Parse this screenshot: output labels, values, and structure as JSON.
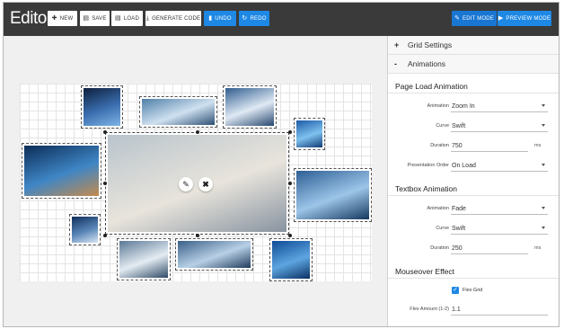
{
  "header": {
    "title": "Editor",
    "buttons": [
      {
        "label": "NEW",
        "icon": "plus-icon"
      },
      {
        "label": "SAVE",
        "icon": "save-icon"
      },
      {
        "label": "LOAD",
        "icon": "load-icon"
      },
      {
        "label": "GENERATE CODE",
        "icon": "download-icon"
      },
      {
        "label": "UNDO",
        "icon": "trash-icon"
      },
      {
        "label": "REDO",
        "icon": "redo-icon"
      }
    ],
    "modes": [
      {
        "label": "EDIT MODE",
        "icon": "edit-mode-icon"
      },
      {
        "label": "PREVIEW MODE",
        "icon": "play-icon"
      }
    ]
  },
  "canvas": {
    "images": [
      {
        "name": "galaxy",
        "colors": [
          "#0d1f3d",
          "#3b6fb0",
          "#7fb4e6"
        ]
      },
      {
        "name": "mountain-lake-wide",
        "colors": [
          "#4f7fa8",
          "#cfe1f0",
          "#2c4e73"
        ]
      },
      {
        "name": "snowy-peaks",
        "colors": [
          "#2f5d8f",
          "#dfe9f4",
          "#27476e"
        ]
      },
      {
        "name": "ice-cave",
        "colors": [
          "#1b5aa6",
          "#7fc1ef",
          "#0e3a75"
        ]
      },
      {
        "name": "lake-reflection",
        "colors": [
          "#0b2d57",
          "#3f86c6",
          "#c38a4e"
        ]
      },
      {
        "name": "road-sunset-main",
        "colors": [
          "#b9c4cc",
          "#e8e4dc",
          "#8893a0"
        ]
      },
      {
        "name": "golden-gate",
        "colors": [
          "#2e5f95",
          "#9cc5e8",
          "#15385e"
        ]
      },
      {
        "name": "blue-tent",
        "colors": [
          "#0f2f5c",
          "#5a86b8",
          "#d8e6f3"
        ]
      },
      {
        "name": "snow-mountain",
        "colors": [
          "#5b7896",
          "#e4ecf2",
          "#2f4a66"
        ]
      },
      {
        "name": "alpine-range",
        "colors": [
          "#3a5f88",
          "#b8d0e6",
          "#1f3b5c"
        ]
      },
      {
        "name": "wave-blue",
        "colors": [
          "#0f4b96",
          "#5da5e0",
          "#0a2f63"
        ]
      }
    ],
    "edit_icon": "pencil-icon",
    "delete_icon": "close-icon"
  },
  "panel": {
    "accordions": [
      {
        "symbol": "+",
        "label": "Grid Settings"
      },
      {
        "symbol": "-",
        "label": "Animations"
      }
    ],
    "page_load": {
      "title": "Page Load Animation",
      "animation_label": "Animation",
      "animation_value": "Zoom In",
      "curve_label": "Curve",
      "curve_value": "Swift",
      "duration_label": "Duration",
      "duration_value": "750",
      "duration_unit": "ms",
      "order_label": "Presentation Order",
      "order_value": "On Load"
    },
    "textbox": {
      "title": "Textbox Animation",
      "animation_label": "Animation",
      "animation_value": "Fade",
      "curve_label": "Curve",
      "curve_value": "Swift",
      "duration_label": "Duration",
      "duration_value": "250",
      "duration_unit": "ms"
    },
    "mouseover": {
      "title": "Mouseover Effect",
      "flex_grid_label": "Flex Grid",
      "flex_grid_checked": true,
      "flex_amount_label": "Flex Amount (1-2)",
      "flex_amount_value": "1.1"
    }
  },
  "colors": {
    "topbar": "#3a3a3a",
    "accent": "#1e88e5"
  }
}
